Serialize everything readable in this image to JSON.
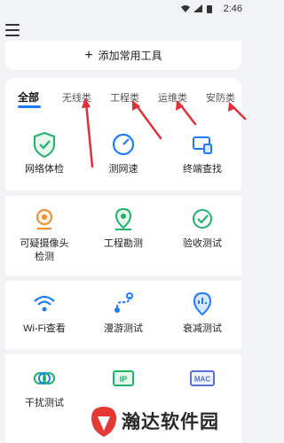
{
  "status_bar": {
    "time": "2:46",
    "icons": [
      "wifi-icon",
      "signal-icon",
      "battery-icon"
    ]
  },
  "add_tool": {
    "label": "添加常用工具"
  },
  "tabs": [
    {
      "label": "全部",
      "active": true
    },
    {
      "label": "无线类",
      "active": false
    },
    {
      "label": "工程类",
      "active": false
    },
    {
      "label": "运维类",
      "active": false
    },
    {
      "label": "安防类",
      "active": false
    }
  ],
  "tools": [
    {
      "label": "网络体检",
      "icon": "shield-check-icon"
    },
    {
      "label": "测网速",
      "icon": "speedometer-icon"
    },
    {
      "label": "终端查找",
      "icon": "device-search-icon"
    },
    {
      "label": "可疑摄像头检测",
      "icon": "camera-icon"
    },
    {
      "label": "工程勘测",
      "icon": "location-pin-icon"
    },
    {
      "label": "验收测试",
      "icon": "check-circle-icon"
    },
    {
      "label": "Wi-Fi查看",
      "icon": "wifi-icon"
    },
    {
      "label": "漫游测试",
      "icon": "roaming-path-icon"
    },
    {
      "label": "衰减测试",
      "icon": "signal-decay-icon"
    },
    {
      "label": "干扰测试",
      "icon": "interference-icon"
    },
    {
      "label": "IP",
      "icon": "ip-icon"
    },
    {
      "label": "MAC",
      "icon": "mac-icon"
    }
  ],
  "watermark": {
    "text": "瀚达软件园"
  },
  "colors": {
    "accent": "#1e7bff",
    "icon_green": "#1fb36b",
    "icon_orange": "#f08c2e",
    "annotation_red": "#e0313a"
  }
}
